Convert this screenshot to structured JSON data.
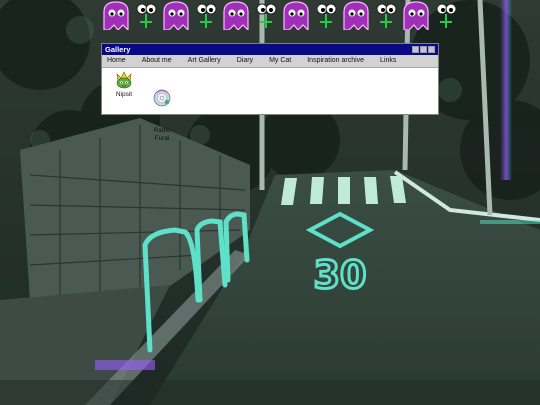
{
  "window": {
    "title": "Gallery"
  },
  "menu": [
    {
      "label": "Home"
    },
    {
      "label": "About me"
    },
    {
      "label": "Art Gallery"
    },
    {
      "label": "Diary"
    },
    {
      "label": "My Cat"
    },
    {
      "label": "Inspiration archive"
    },
    {
      "label": "Links"
    }
  ],
  "icons": [
    {
      "label": "Nipsit",
      "icon": "character-sticker-icon"
    },
    {
      "label": "Radio\nFurai",
      "icon": "radio-disc-icon"
    }
  ],
  "scene": {
    "road_marking": "30"
  },
  "colors": {
    "titlebar": "#0a0a86",
    "menubar": "#d2d2d2",
    "ghost": "#e060f0",
    "street_cyan": "#5fe0c8"
  }
}
